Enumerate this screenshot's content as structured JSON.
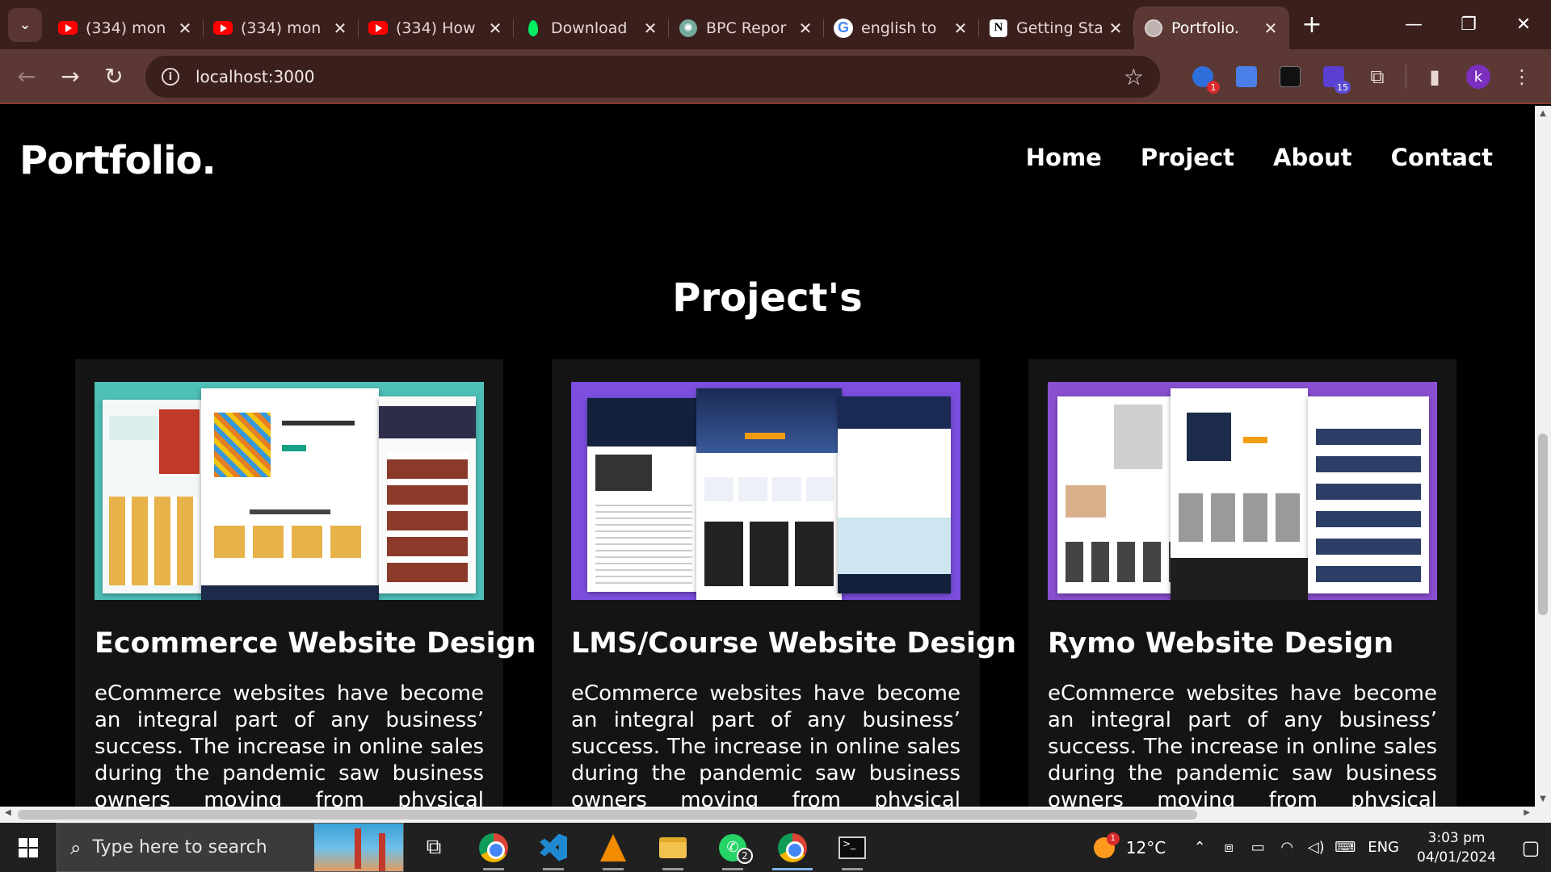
{
  "browser": {
    "tabs": [
      {
        "title": "(334) mon",
        "favicon": "youtube-icon",
        "active": false
      },
      {
        "title": "(334) mon",
        "favicon": "youtube-icon",
        "active": false
      },
      {
        "title": "(334) How",
        "favicon": "youtube-icon",
        "active": false
      },
      {
        "title": "Download",
        "favicon": "mongodb-leaf-icon",
        "active": false
      },
      {
        "title": "BPC Repor",
        "favicon": "chatgpt-icon",
        "active": false
      },
      {
        "title": "english to",
        "favicon": "google-icon",
        "active": false
      },
      {
        "title": "Getting Sta",
        "favicon": "notion-icon",
        "active": false
      },
      {
        "title": "Portfolio.",
        "favicon": "globe-icon",
        "active": true
      }
    ],
    "url": "localhost:3000",
    "extensions": [
      {
        "name": "copilot-extension-icon",
        "badge": "1"
      },
      {
        "name": "google-translate-icon",
        "badge": ""
      },
      {
        "name": "chatgpt-extension-icon",
        "badge": ""
      },
      {
        "name": "bookmark-extension-icon",
        "badge": "15"
      }
    ],
    "profile_initial": "k"
  },
  "site": {
    "logo": "Portfolio.",
    "nav": [
      "Home",
      "Project",
      "About",
      "Contact"
    ],
    "section_title": "Project's",
    "projects": [
      {
        "title": "Ecommerce Website Design",
        "description": "eCommerce websites have become an integral part of any business’ success. The increase in online sales during the pandemic saw business owners moving from physical storefronts to digital",
        "thumb_bg": "#4ec0b8"
      },
      {
        "title": "LMS/Course Website Design",
        "description": "eCommerce websites have become an integral part of any business’ success. The increase in online sales during the pandemic saw business owners moving from physical storefronts to digital",
        "thumb_bg": "#7c4fe0"
      },
      {
        "title": "Rymo Website Design",
        "description": "eCommerce websites have become an integral part of any business’ success. The increase in online sales during the pandemic saw business owners moving from physical storefronts to digital",
        "thumb_bg": "#8a4fd0"
      }
    ]
  },
  "taskbar": {
    "search_placeholder": "Type here to search",
    "apps": [
      {
        "name": "task-view-icon"
      },
      {
        "name": "chrome-icon",
        "state": "running"
      },
      {
        "name": "vscode-icon",
        "state": "running"
      },
      {
        "name": "vlc-icon",
        "state": "running"
      },
      {
        "name": "file-explorer-icon",
        "state": "running"
      },
      {
        "name": "whatsapp-icon",
        "badge": "2",
        "state": "running"
      },
      {
        "name": "chrome-profile-icon",
        "state": "active"
      },
      {
        "name": "terminal-icon",
        "state": "running"
      }
    ],
    "weather_temp": "12°C",
    "weather_badge": "1",
    "language": "ENG",
    "time": "3:03 pm",
    "date": "04/01/2024"
  },
  "colors": {
    "chrome_tabbar": "#3a1f1c",
    "chrome_toolbar": "#5b3833",
    "page_bg": "#000000",
    "card_bg": "#141414"
  }
}
